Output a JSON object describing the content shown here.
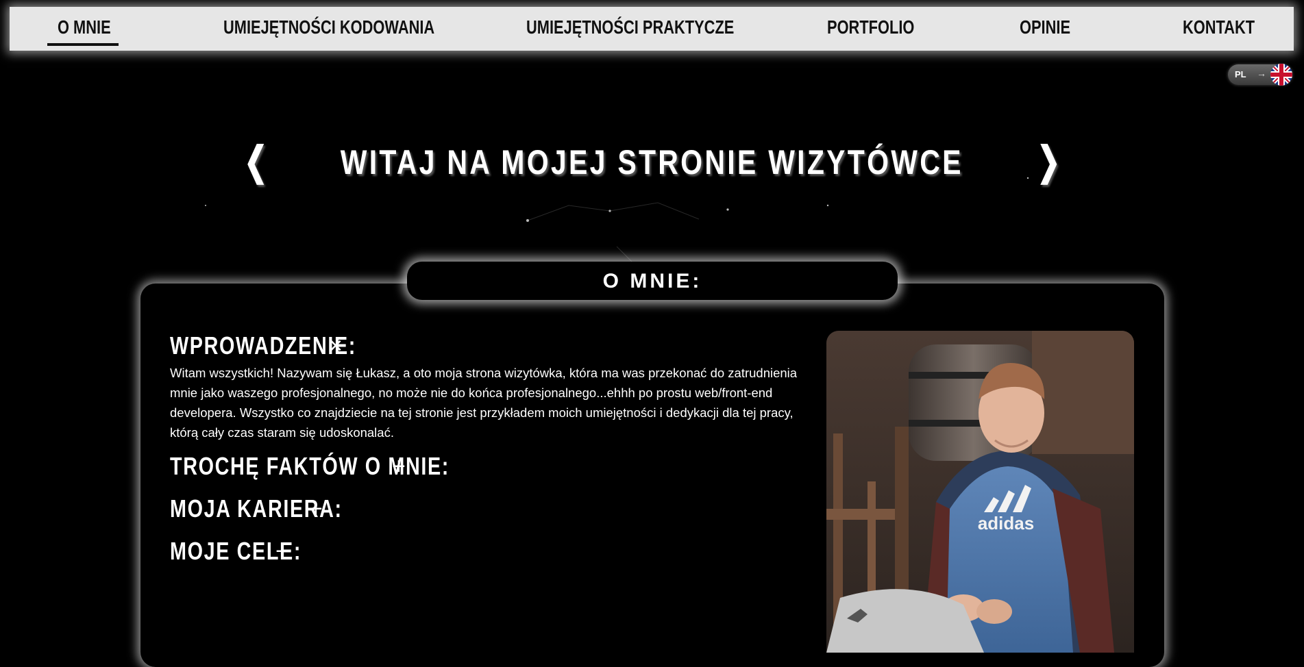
{
  "nav": {
    "items": [
      {
        "label": "O MNIE",
        "active": true
      },
      {
        "label": "UMIEJĘTNOŚCI KODOWANIA",
        "active": false
      },
      {
        "label": "UMIEJĘTNOŚCI PRAKTYCZE",
        "active": false
      },
      {
        "label": "PORTFOLIO",
        "active": false
      },
      {
        "label": "OPINIE",
        "active": false
      },
      {
        "label": "KONTAKT",
        "active": false
      }
    ]
  },
  "lang_switch": {
    "current": "PL",
    "arrow": "→",
    "target_flag": "uk-flag-icon"
  },
  "headline": {
    "left_chevron": "❮",
    "text": "WITAJ NA MOJEJ STRONIE WIZYTÓWCE",
    "right_chevron": "❯"
  },
  "about": {
    "title": "O MNIE:",
    "sections": [
      {
        "heading": "WPROWADZENIE:",
        "toggle": "×",
        "expanded": true,
        "body": "Witam wszystkich! Nazywam się Łukasz, a oto moja strona wizytówka, która ma was przekonać do zatrudnienia mnie jako waszego profesjonalnego, no może nie do końca profesjonalnego...ehhh po prostu web/front-end developera. Wszystko co znajdziecie na tej stronie jest przykładem moich umiejętności i dedykacji dla tej pracy, którą cały czas staram się udoskonalać."
      },
      {
        "heading": "TROCHĘ FAKTÓW O MNIE:",
        "toggle": "+",
        "expanded": false
      },
      {
        "heading": "MOJA KARIERA:",
        "toggle": "+",
        "expanded": false
      },
      {
        "heading": "MOJE CELE:",
        "toggle": "+",
        "expanded": false
      }
    ],
    "photo": "profile-photo",
    "photo_shirt_text": "adidas"
  },
  "colors": {
    "background": "#000000",
    "nav_bg": "#e6e6e6",
    "nav_text": "#111111",
    "glow": "#ffffff",
    "text": "#ffffff"
  }
}
